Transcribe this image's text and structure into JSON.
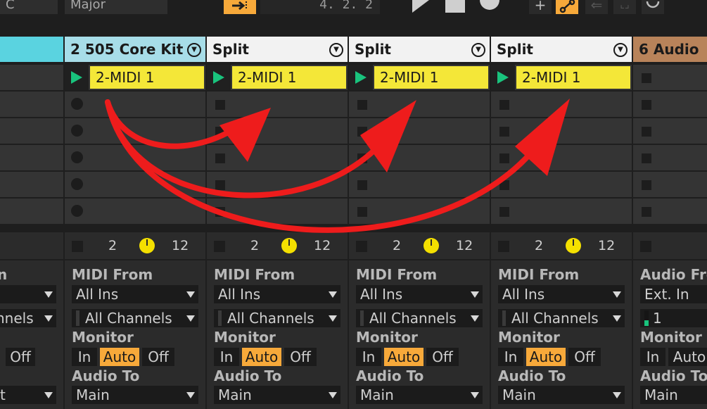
{
  "topbar": {
    "key": "C",
    "scale": "Major",
    "follow_icon": "follow-arrow-icon",
    "arrangement_position": "4.  2.  2",
    "transport": [
      "play-icon",
      "stop-icon",
      "record-icon"
    ],
    "right_buttons": [
      "add-icon",
      "draw-mode-icon",
      "back-arrow-icon",
      "expand-icon",
      "loop-icon"
    ]
  },
  "colors": {
    "drum_track": "#a7dde8",
    "left_track": "#5ad3e0",
    "split_track": "#f2f2f2",
    "audio_track": "#b8835a",
    "clip": "#f4e738",
    "clip_play": "#19c37d",
    "auto_on": "#f7a93a",
    "knob": "#f4e000",
    "arrow": "#ee1c1c"
  },
  "left_partial": {
    "io_label": "n",
    "input_channel": "nnels",
    "monitor_off": "Off",
    "audio_to": "t"
  },
  "tracks": [
    {
      "name": "2 505 Core Kit",
      "clip": "2-MIDI 1",
      "status_left": "2",
      "status_right": "12",
      "io_label": "MIDI From",
      "input_type": "All Ins",
      "input_channel": "All Channels",
      "monitor_label": "Monitor",
      "monitor": [
        "In",
        "Auto",
        "Off"
      ],
      "output_label": "Audio To",
      "output": "Main"
    },
    {
      "name": "Split",
      "clip": "2-MIDI 1",
      "status_left": "2",
      "status_right": "12",
      "io_label": "MIDI From",
      "input_type": "All Ins",
      "input_channel": "All Channels",
      "monitor_label": "Monitor",
      "monitor": [
        "In",
        "Auto",
        "Off"
      ],
      "output_label": "Audio To",
      "output": "Main"
    },
    {
      "name": "Split",
      "clip": "2-MIDI 1",
      "status_left": "2",
      "status_right": "12",
      "io_label": "MIDI From",
      "input_type": "All Ins",
      "input_channel": "All Channels",
      "monitor_label": "Monitor",
      "monitor": [
        "In",
        "Auto",
        "Off"
      ],
      "output_label": "Audio To",
      "output": "Main"
    },
    {
      "name": "Split",
      "clip": "2-MIDI 1",
      "status_left": "2",
      "status_right": "12",
      "io_label": "MIDI From",
      "input_type": "All Ins",
      "input_channel": "All Channels",
      "monitor_label": "Monitor",
      "monitor": [
        "In",
        "Auto",
        "Off"
      ],
      "output_label": "Audio To",
      "output": "Main"
    },
    {
      "name": "6 Audio",
      "io_label": "Audio Fro",
      "input_type": "Ext. In",
      "input_channel": "1",
      "monitor_label": "Monitor",
      "monitor": [
        "In",
        "Auto"
      ],
      "output_label": "Audio To",
      "output": "Main"
    }
  ]
}
